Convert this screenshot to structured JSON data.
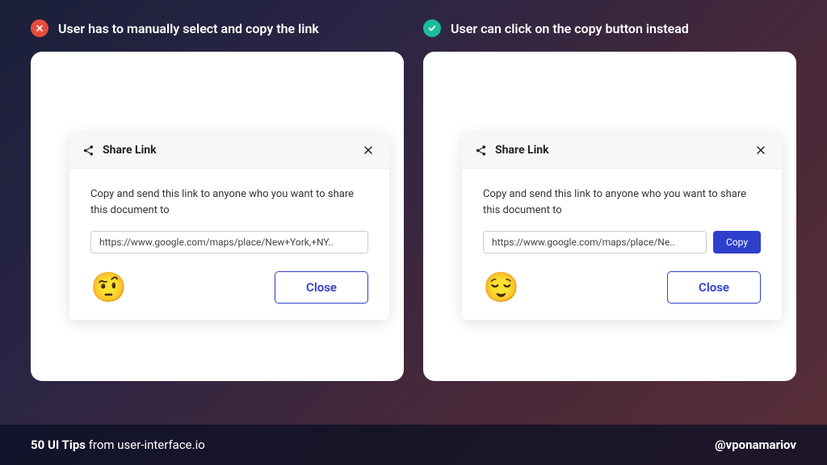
{
  "left": {
    "header": "User has to manually select and copy the link",
    "dialog": {
      "title": "Share Link",
      "description": "Copy and send this link to anyone who you want to share this document to",
      "link_value": "https://www.google.com/maps/place/New+York,+NY..",
      "emoji": "🤨",
      "close_label": "Close"
    }
  },
  "right": {
    "header": "User can click on the copy button instead",
    "dialog": {
      "title": "Share Link",
      "description": "Copy and send this link to anyone who you want to share this document to",
      "link_value": "https://www.google.com/maps/place/Ne..",
      "copy_label": "Copy",
      "emoji": "😌",
      "close_label": "Close"
    }
  },
  "footer": {
    "bold": "50 UI Tips",
    "rest": " from user-interface.io",
    "handle": "@vponamariov"
  }
}
